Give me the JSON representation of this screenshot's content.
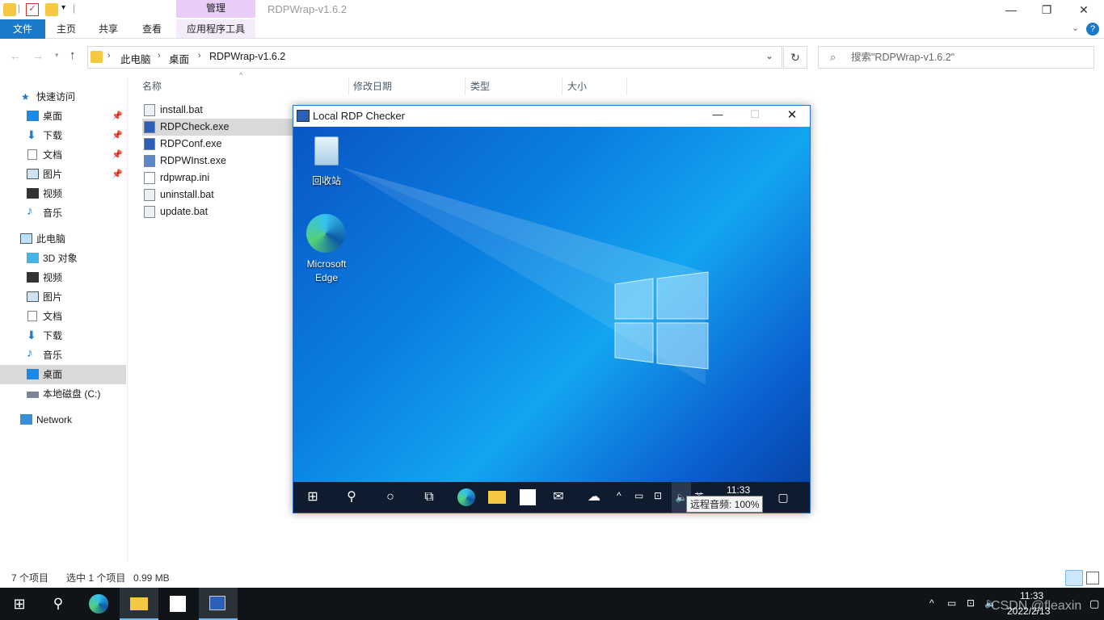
{
  "window": {
    "title": "RDPWrap-v1.6.2",
    "manage_label": "管理",
    "tabs": [
      "文件",
      "主页",
      "共享",
      "查看",
      "应用程序工具"
    ],
    "controls": {
      "minimize": "—",
      "maximize": "❐",
      "close": "✕"
    }
  },
  "address": {
    "path": [
      "此电脑",
      "桌面",
      "RDPWrap-v1.6.2"
    ],
    "search_placeholder": "搜索\"RDPWrap-v1.6.2\""
  },
  "navpane": {
    "quick_access": "快速访问",
    "quick_items": [
      "桌面",
      "下载",
      "文档",
      "图片",
      "视频",
      "音乐"
    ],
    "this_pc": "此电脑",
    "pc_items": [
      "3D 对象",
      "视频",
      "图片",
      "文档",
      "下载",
      "音乐",
      "桌面",
      "本地磁盘 (C:)"
    ],
    "network": "Network"
  },
  "columns": [
    "名称",
    "修改日期",
    "类型",
    "大小"
  ],
  "files": [
    "install.bat",
    "RDPCheck.exe",
    "RDPConf.exe",
    "RDPWInst.exe",
    "rdpwrap.ini",
    "uninstall.bat",
    "update.bat"
  ],
  "status": {
    "count": "7 个项目",
    "selected": "选中 1 个项目",
    "size": "0.99 MB"
  },
  "rdp": {
    "title": "Local RDP Checker",
    "desktop_icons": [
      "回收站",
      "Microsoft Edge"
    ],
    "clock": "11:33",
    "tooltip": "远程音频: 100%",
    "ime": "英"
  },
  "taskbar": {
    "time": "11:33",
    "date": "2022/2/13",
    "watermark": "CSDN @fleaxin"
  },
  "colors": {
    "accent": "#1979ca",
    "manage": "#e8cdf6",
    "selected": "#cce8ff"
  }
}
